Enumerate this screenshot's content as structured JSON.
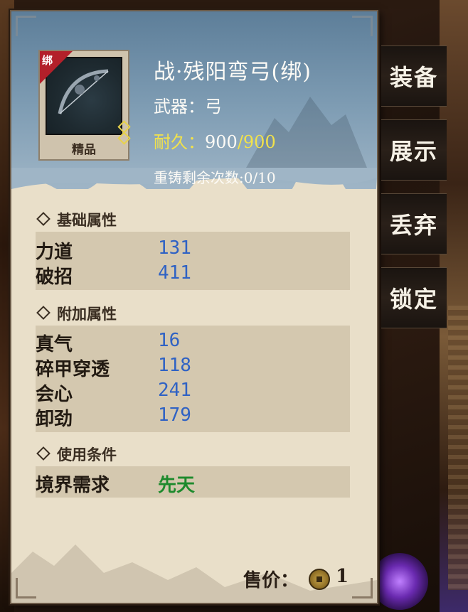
{
  "item": {
    "name": "战·残阳弯弓(绑)",
    "bind_tag": "绑",
    "quality": "精品",
    "type_label": "武器：",
    "type_value": "弓",
    "durability_label": "耐久：",
    "durability_current": "900",
    "durability_max": "/900",
    "recast": "重铸剩余次数:0/10"
  },
  "sections": {
    "base": {
      "title": "基础属性",
      "stats": [
        {
          "name": "力道",
          "value": "131"
        },
        {
          "name": "破招",
          "value": "411"
        }
      ]
    },
    "extra": {
      "title": "附加属性",
      "stats": [
        {
          "name": "真气",
          "value": "16"
        },
        {
          "name": "碎甲穿透",
          "value": "118"
        },
        {
          "name": "会心",
          "value": "241"
        },
        {
          "name": "卸劲",
          "value": "179"
        }
      ]
    },
    "requirement": {
      "title": "使用条件",
      "label": "境界需求",
      "value": "先天"
    }
  },
  "price": {
    "label": "售价：",
    "value": "1"
  },
  "actions": [
    {
      "label": "装备"
    },
    {
      "label": "展示"
    },
    {
      "label": "丢弃"
    },
    {
      "label": "锁定"
    }
  ],
  "colors": {
    "stat_value": "#2f62c4",
    "requirement_value": "#1d8a2c",
    "durability_highlight": "#f2e24a",
    "bind_tag": "#b3202a"
  }
}
